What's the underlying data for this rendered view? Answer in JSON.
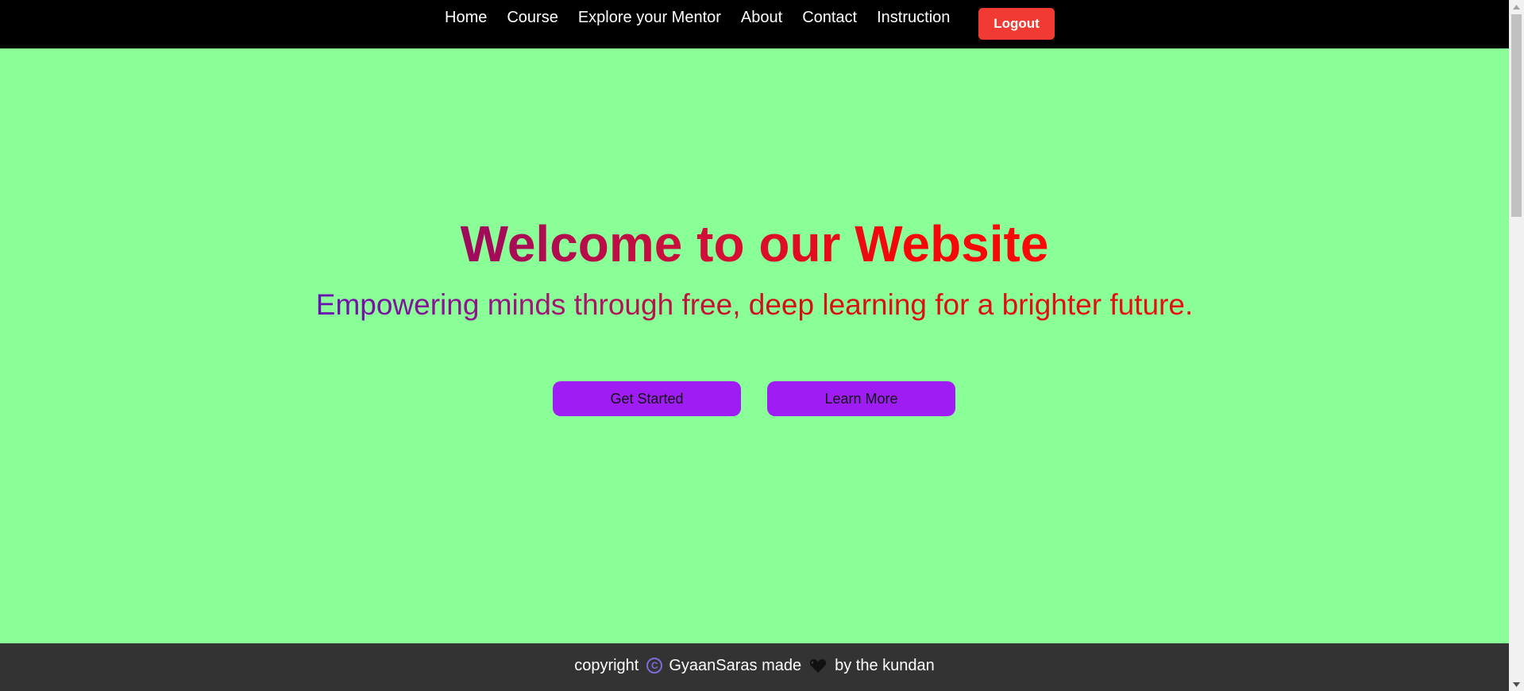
{
  "navbar": {
    "links": [
      "Home",
      "Course",
      "Explore your Mentor",
      "About",
      "Contact",
      "Instruction"
    ],
    "logout_label": "Logout"
  },
  "hero": {
    "title": "Welcome to our Website",
    "subtitle": "Empowering minds through free, deep learning for a brighter future.",
    "get_started_label": "Get Started",
    "learn_more_label": "Learn More"
  },
  "footer": {
    "prefix": "copyright",
    "icon": "copyright-icon",
    "brand_text": "GyaanSaras made",
    "heart_icon": "heart-icon",
    "suffix": "by the kundan"
  },
  "colors": {
    "background": "#8aff98",
    "navbar": "#000000",
    "logout_button": "#f13a32",
    "hero_buttons": "#a01cf5",
    "footer": "#333333"
  }
}
